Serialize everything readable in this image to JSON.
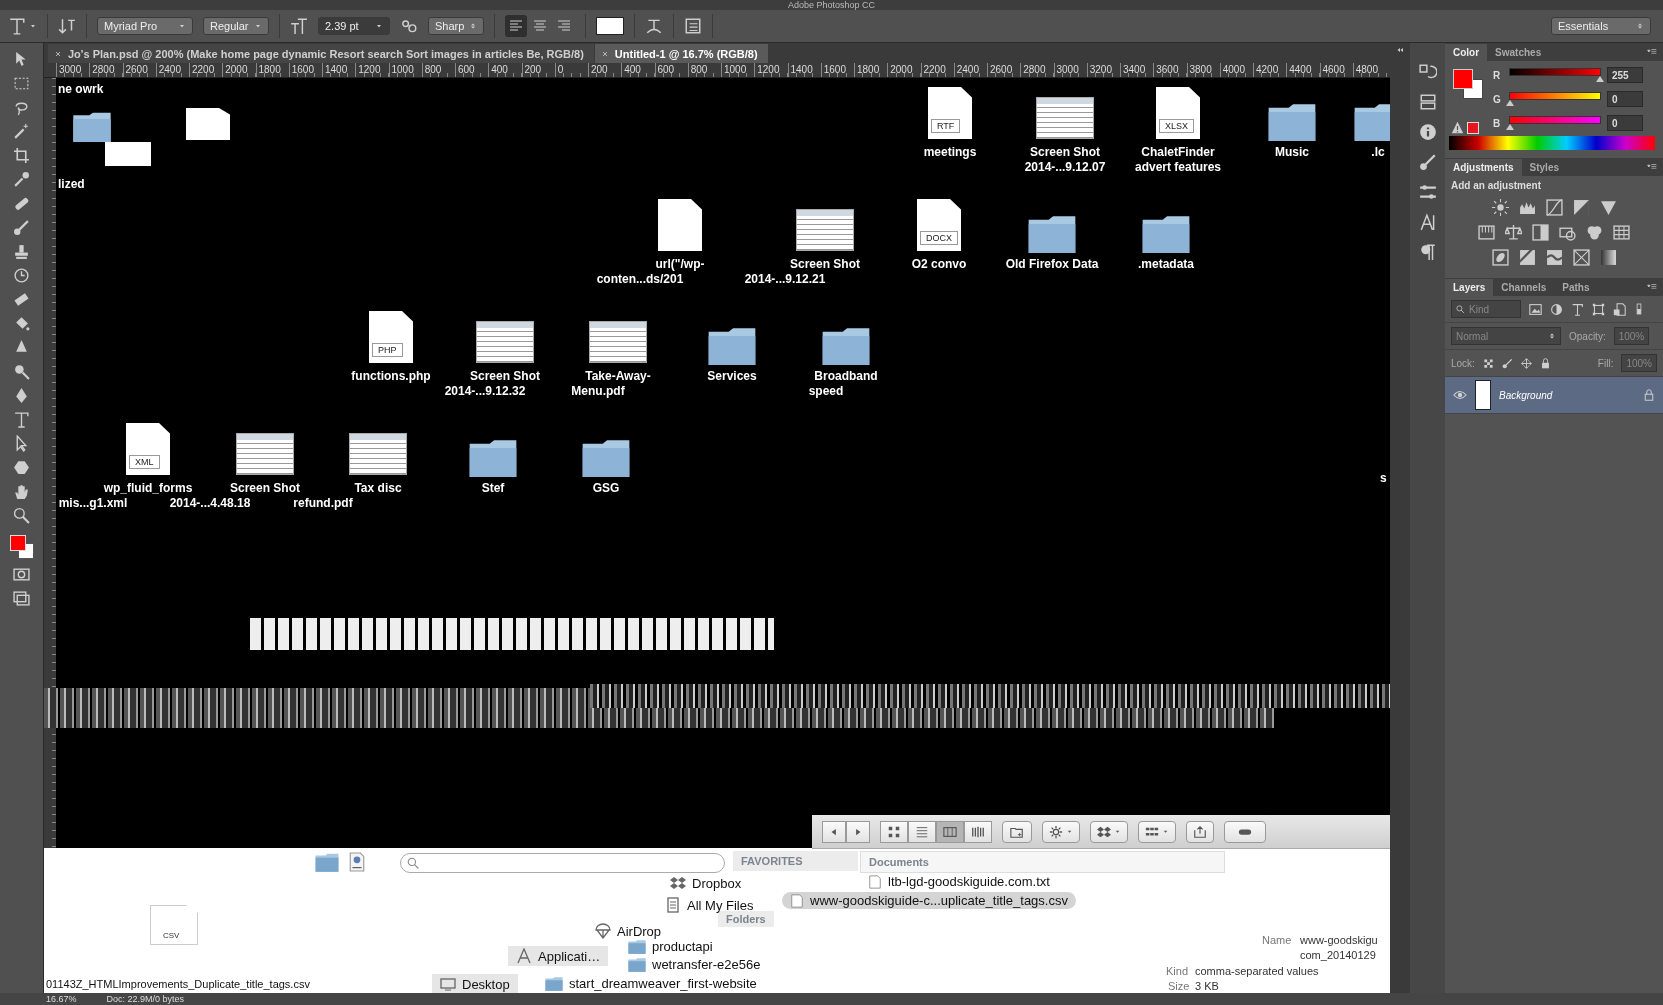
{
  "app_title": "Adobe Photoshop CC",
  "options_bar": {
    "font_family": "Myriad Pro",
    "font_style": "Regular",
    "font_size": "2.39 pt",
    "antialias": "Sharp",
    "align": [
      {
        "selected": true
      },
      {
        "selected": false
      },
      {
        "selected": false
      }
    ],
    "workspace": "Essentials"
  },
  "tabs": [
    {
      "label": "Jo's Plan.psd @ 200% (Make home page dynamic Resort search Sort images in articles Be, RGB/8)",
      "selected": false
    },
    {
      "label": "Untitled-1 @ 16.7% (RGB/8)",
      "selected": true
    }
  ],
  "ruler": [
    "3000",
    "2800",
    "2600",
    "2400",
    "2200",
    "2000",
    "1800",
    "1600",
    "1400",
    "1200",
    "1000",
    "800",
    "600",
    "400",
    "200",
    "0",
    "200",
    "400",
    "600",
    "800",
    "1000",
    "1200",
    "1400",
    "1600",
    "1800",
    "2000",
    "2200",
    "2400",
    "2600",
    "2800",
    "3000",
    "3200",
    "3400",
    "3600",
    "3800",
    "4000",
    "4200",
    "4400",
    "4600",
    "4800"
  ],
  "canvas": {
    "fragments": [
      "ne owrk",
      "lized",
      "s"
    ],
    "rows": [
      {
        "items": [
          {
            "kind": "document",
            "badge": "RTF",
            "lines": [
              "meetings"
            ]
          },
          {
            "kind": "screenshot",
            "lines": [
              "Screen Shot",
              "2014-...9.12.07"
            ]
          },
          {
            "kind": "document",
            "badge": "XLSX",
            "lines": [
              "ChaletFinder",
              "advert features"
            ]
          },
          {
            "kind": "folder",
            "lines": [
              "Music"
            ]
          },
          {
            "kind": "folder",
            "lines": [
              ".lc"
            ]
          }
        ]
      },
      {
        "items": [
          {
            "kind": "document",
            "lines": [
              "url(\"/wp-",
              "conten...ds/201"
            ]
          },
          {
            "kind": "screenshot",
            "lines": [
              "Screen Shot",
              "2014-...9.12.21"
            ]
          },
          {
            "kind": "document",
            "badge": "DOCX",
            "lines": [
              "O2 convo"
            ]
          },
          {
            "kind": "folder",
            "lines": [
              "Old Firefox Data"
            ]
          },
          {
            "kind": "folder",
            "lines": [
              ".metadata"
            ]
          }
        ]
      },
      {
        "items": [
          {
            "kind": "document",
            "badge": "PHP",
            "lines": [
              "functions.php"
            ]
          },
          {
            "kind": "screenshot",
            "lines": [
              "Screen Shot",
              "2014-...9.12.32"
            ]
          },
          {
            "kind": "screenshot",
            "lines": [
              "Take-Away-",
              "Menu.pdf"
            ]
          },
          {
            "kind": "folder",
            "lines": [
              "Services"
            ]
          },
          {
            "kind": "folder",
            "lines": [
              "Broadband",
              "speed"
            ]
          }
        ]
      },
      {
        "items": [
          {
            "kind": "document",
            "badge": "XML",
            "lines": [
              "wp_fluid_forms",
              "mis...g1.xml"
            ]
          },
          {
            "kind": "screenshot",
            "lines": [
              "Screen Shot",
              "2014-...4.48.18"
            ]
          },
          {
            "kind": "screenshot",
            "lines": [
              "Tax disc",
              "refund.pdf"
            ]
          },
          {
            "kind": "folder",
            "lines": [
              "Stef"
            ]
          },
          {
            "kind": "folder",
            "lines": [
              "GSG"
            ]
          }
        ]
      }
    ]
  },
  "finder": {
    "view_modes": [
      {
        "selected": false
      },
      {
        "selected": false
      },
      {
        "selected": true
      },
      {
        "selected": false
      }
    ],
    "favorites_heading": "FAVORITES",
    "column_heading": "Documents",
    "files": [
      {
        "label": "ltb-lgd-goodskiguide.com.txt",
        "selected": false
      },
      {
        "label": "www-goodskiguide-c...uplicate_title_tags.csv",
        "selected": true
      }
    ],
    "sidebar": [
      {
        "kind": "dropbox",
        "label": "Dropbox"
      },
      {
        "kind": "files",
        "label": "All My Files"
      },
      {
        "kind": "airdrop",
        "label": "AirDrop"
      },
      {
        "kind": "apps",
        "label": "Applicati…"
      },
      {
        "kind": "desktop",
        "label": "Desktop"
      }
    ],
    "folders_heading": "Folders",
    "folders": [
      "productapi",
      "wetransfer-e2e56e",
      "start_dreamweaver_first-website"
    ],
    "preview": {
      "badge": "CSV",
      "name_label": "Name",
      "name_lines": [
        "www-goodskigu",
        "com_20140129"
      ],
      "kind_label": "Kind",
      "kind": "comma-separated values",
      "size_label": "Size",
      "size": "3 KB"
    },
    "filename": "01143Z_HTMLImprovements_Duplicate_title_tags.csv"
  },
  "status_bar": {
    "zoom": "16.67%",
    "doc": "Doc: 22.9M/0 bytes"
  },
  "color_panel": {
    "tabs": [
      {
        "label": "Color",
        "selected": true
      },
      {
        "label": "Swatches",
        "selected": false
      }
    ],
    "channels": [
      {
        "label": "R",
        "level": 1,
        "value": "255"
      },
      {
        "label": "G",
        "level": 0,
        "value": "0"
      },
      {
        "label": "B",
        "level": 0,
        "value": "0"
      }
    ]
  },
  "adjustments_panel": {
    "tabs": [
      {
        "label": "Adjustments",
        "selected": true
      },
      {
        "label": "Styles",
        "selected": false
      }
    ],
    "heading": "Add an adjustment"
  },
  "layers_panel": {
    "tabs": [
      {
        "label": "Layers",
        "selected": true
      },
      {
        "label": "Channels",
        "selected": false
      },
      {
        "label": "Paths",
        "selected": false
      }
    ],
    "filter": "Kind",
    "blend_mode": "Normal",
    "opacity_label": "Opacity:",
    "opacity": "100%",
    "lock_label": "Lock:",
    "fill_label": "Fill:",
    "fill": "100%",
    "layers": [
      {
        "name": "Background",
        "selected": true,
        "visible": true,
        "locked": true
      }
    ]
  }
}
